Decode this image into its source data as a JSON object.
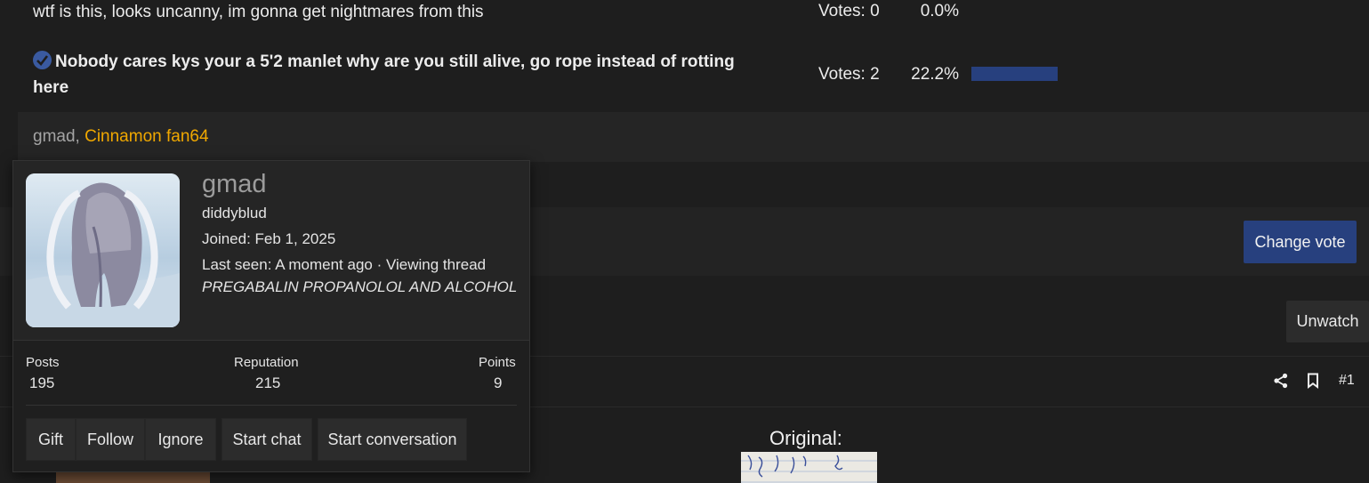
{
  "poll": {
    "options": [
      {
        "text": "wtf is this, looks uncanny, im gonna get nightmares from this",
        "votes": "Votes: 0",
        "percent": "0.0%",
        "fraction": 0.0
      },
      {
        "text": "Nobody cares kys your a 5'2 manlet why are you still alive, go rope instead of rotting here",
        "votes": "Votes: 2",
        "percent": "22.2%",
        "fraction": 0.222,
        "selected": true
      }
    ],
    "voters": {
      "user1": "gmad",
      "separator": ", ",
      "user2": "Cinnamon fan64"
    },
    "change_vote_label": "Change vote",
    "accent": "#27407e"
  },
  "thread": {
    "unwatch_label": "Unwatch",
    "post_number": "#1",
    "original_label": "Original:"
  },
  "member_tooltip": {
    "username": "gmad",
    "user_title": "diddyblud",
    "joined": "Joined: Feb 1, 2025",
    "last_seen": "Last seen: A moment ago · Viewing thread",
    "thread_title": "PREGABALIN PROPANOLOL AND ALCOHOL",
    "stats": {
      "posts_label": "Posts",
      "posts_value": "195",
      "reputation_label": "Reputation",
      "reputation_value": "215",
      "points_label": "Points",
      "points_value": "9"
    },
    "actions": {
      "gift": "Gift",
      "follow": "Follow",
      "ignore": "Ignore",
      "start_chat": "Start chat",
      "start_conversation": "Start conversation"
    }
  },
  "icons": [
    "check-circle-icon",
    "share-icon",
    "bookmark-icon"
  ]
}
